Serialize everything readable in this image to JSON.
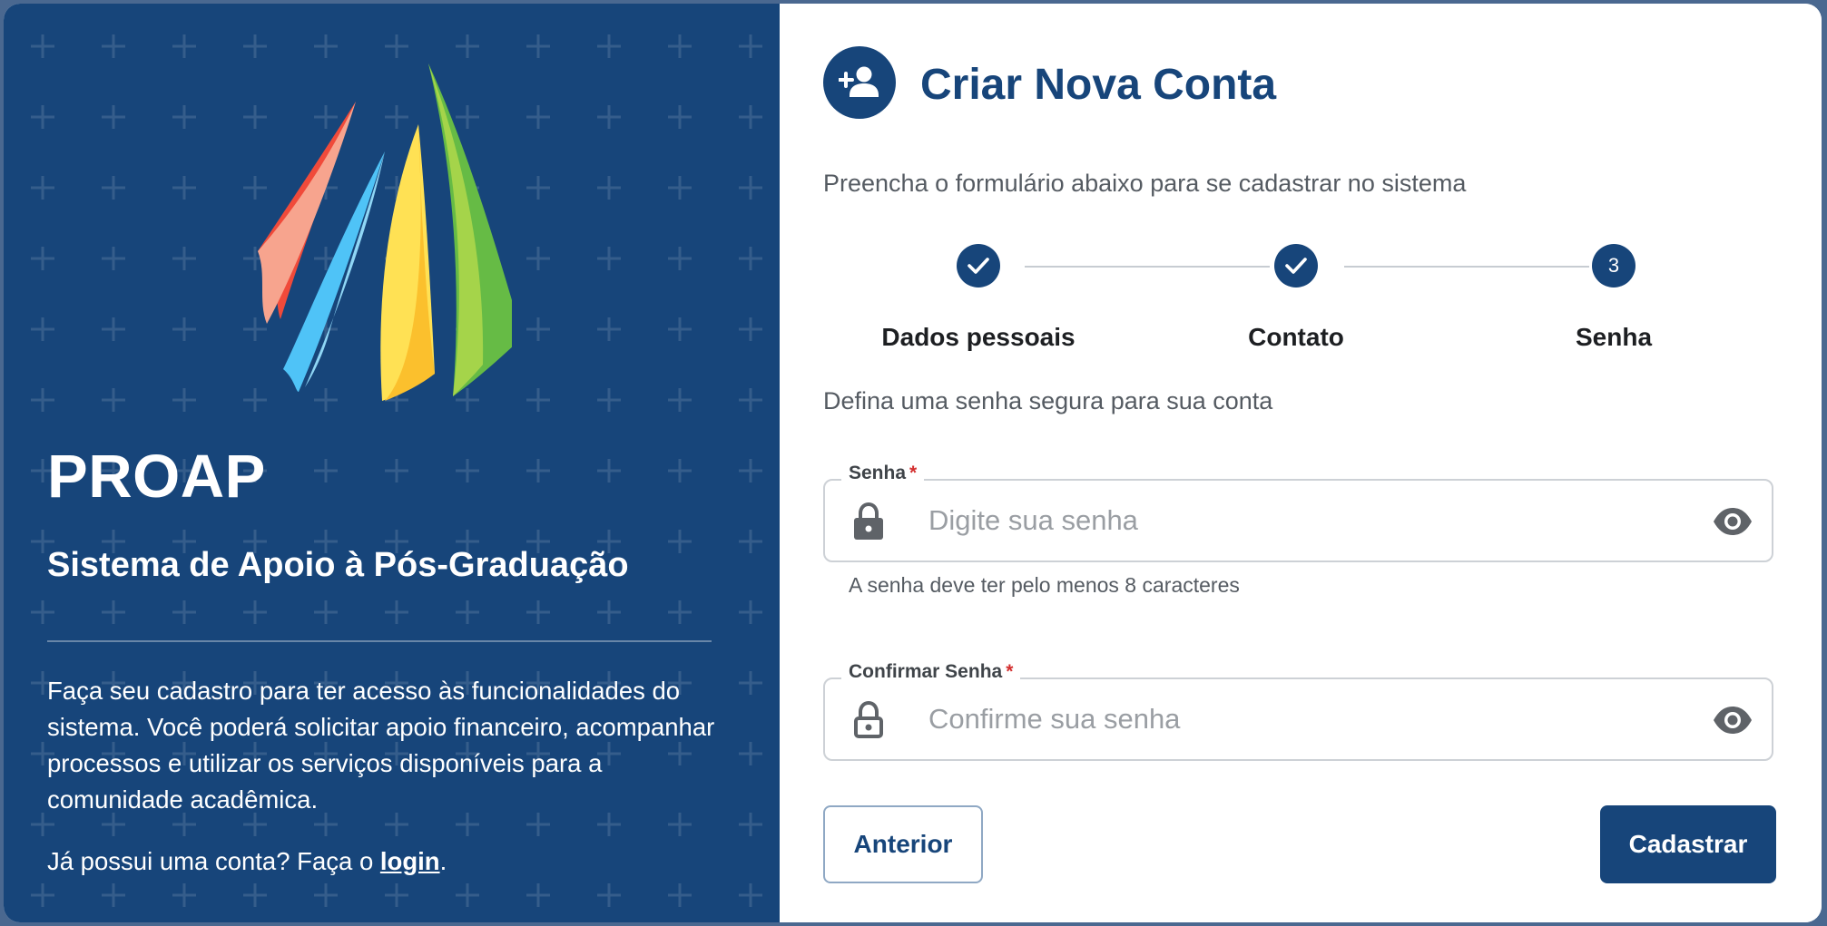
{
  "brand": {
    "name": "PROAP",
    "subtitle": "Sistema de Apoio à Pós-Graduação",
    "description": "Faça seu cadastro para ter acesso às funcionalidades do sistema. Você poderá solicitar apoio financeiro, acompanhar processos e utilizar os serviços disponíveis para a comunidade acadêmica.",
    "login_prefix": "Já possui uma conta? Faça o ",
    "login_link": "login",
    "login_suffix": "."
  },
  "form": {
    "title": "Criar Nova Conta",
    "subtitle": "Preencha o formulário abaixo para se cadastrar no sistema",
    "section_text": "Defina uma senha segura para sua conta",
    "steps": [
      {
        "label": "Dados pessoais",
        "status": "completed"
      },
      {
        "label": "Contato",
        "status": "completed"
      },
      {
        "label": "Senha",
        "status": "active",
        "number": "3"
      }
    ],
    "password": {
      "label": "Senha",
      "required_mark": "*",
      "placeholder": "Digite sua senha",
      "value": "",
      "helper": "A senha deve ter pelo menos 8 caracteres"
    },
    "confirm_password": {
      "label": "Confirmar Senha",
      "required_mark": "*",
      "placeholder": "Confirme sua senha",
      "value": ""
    },
    "buttons": {
      "previous": "Anterior",
      "submit": "Cadastrar"
    }
  },
  "colors": {
    "primary": "#17457a",
    "background": "#4a6890",
    "required": "#d32f2f"
  },
  "icons": {
    "header": "person-add-icon",
    "step_done": "check-icon",
    "field": "lock-icon",
    "visibility": "eye-icon"
  }
}
